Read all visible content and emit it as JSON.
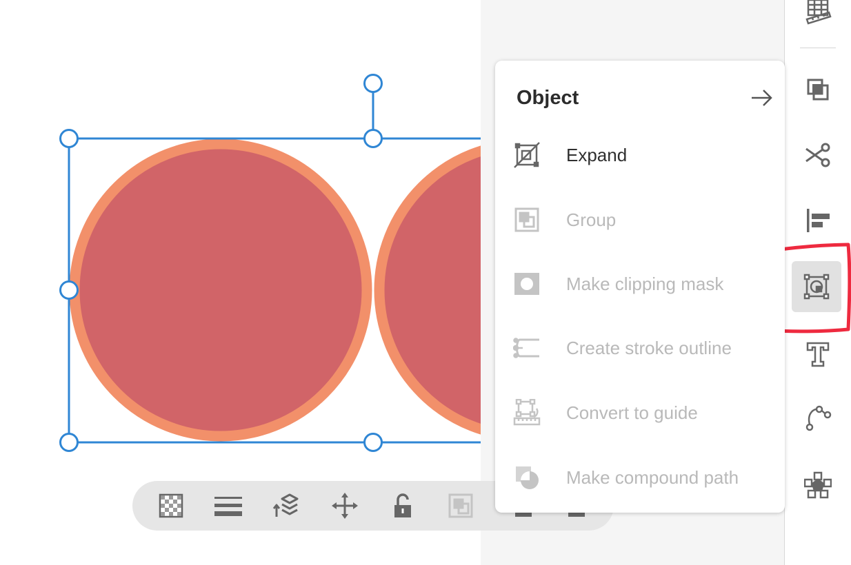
{
  "menu": {
    "title": "Object",
    "items": [
      {
        "label": "Expand",
        "icon": "expand-icon",
        "enabled": true
      },
      {
        "label": "Group",
        "icon": "group-icon",
        "enabled": false
      },
      {
        "label": "Make clipping mask",
        "icon": "clipping-mask-icon",
        "enabled": false
      },
      {
        "label": "Create stroke outline",
        "icon": "stroke-outline-icon",
        "enabled": false
      },
      {
        "label": "Convert to guide",
        "icon": "guide-icon",
        "enabled": false
      },
      {
        "label": "Make compound path",
        "icon": "compound-path-icon",
        "enabled": false
      }
    ]
  },
  "right_toolbar": {
    "icons": [
      "ruler-grid-icon",
      "arrange-icon",
      "scissors-icon",
      "align-icon",
      "object-icon",
      "text-icon",
      "path-icon",
      "repeat-icon"
    ],
    "active": "object-icon"
  },
  "bottom_toolbar": {
    "icons": [
      "opacity-icon",
      "stroke-weight-icon",
      "layers-icon",
      "move-icon",
      "lock-icon",
      "group-icon",
      "more-icon-1",
      "more-icon-2"
    ]
  },
  "colors": {
    "circle_fill": "#d16468",
    "circle_stroke": "#f2906a",
    "selection": "#2f86d4",
    "annotation": "#ee2a3f"
  }
}
